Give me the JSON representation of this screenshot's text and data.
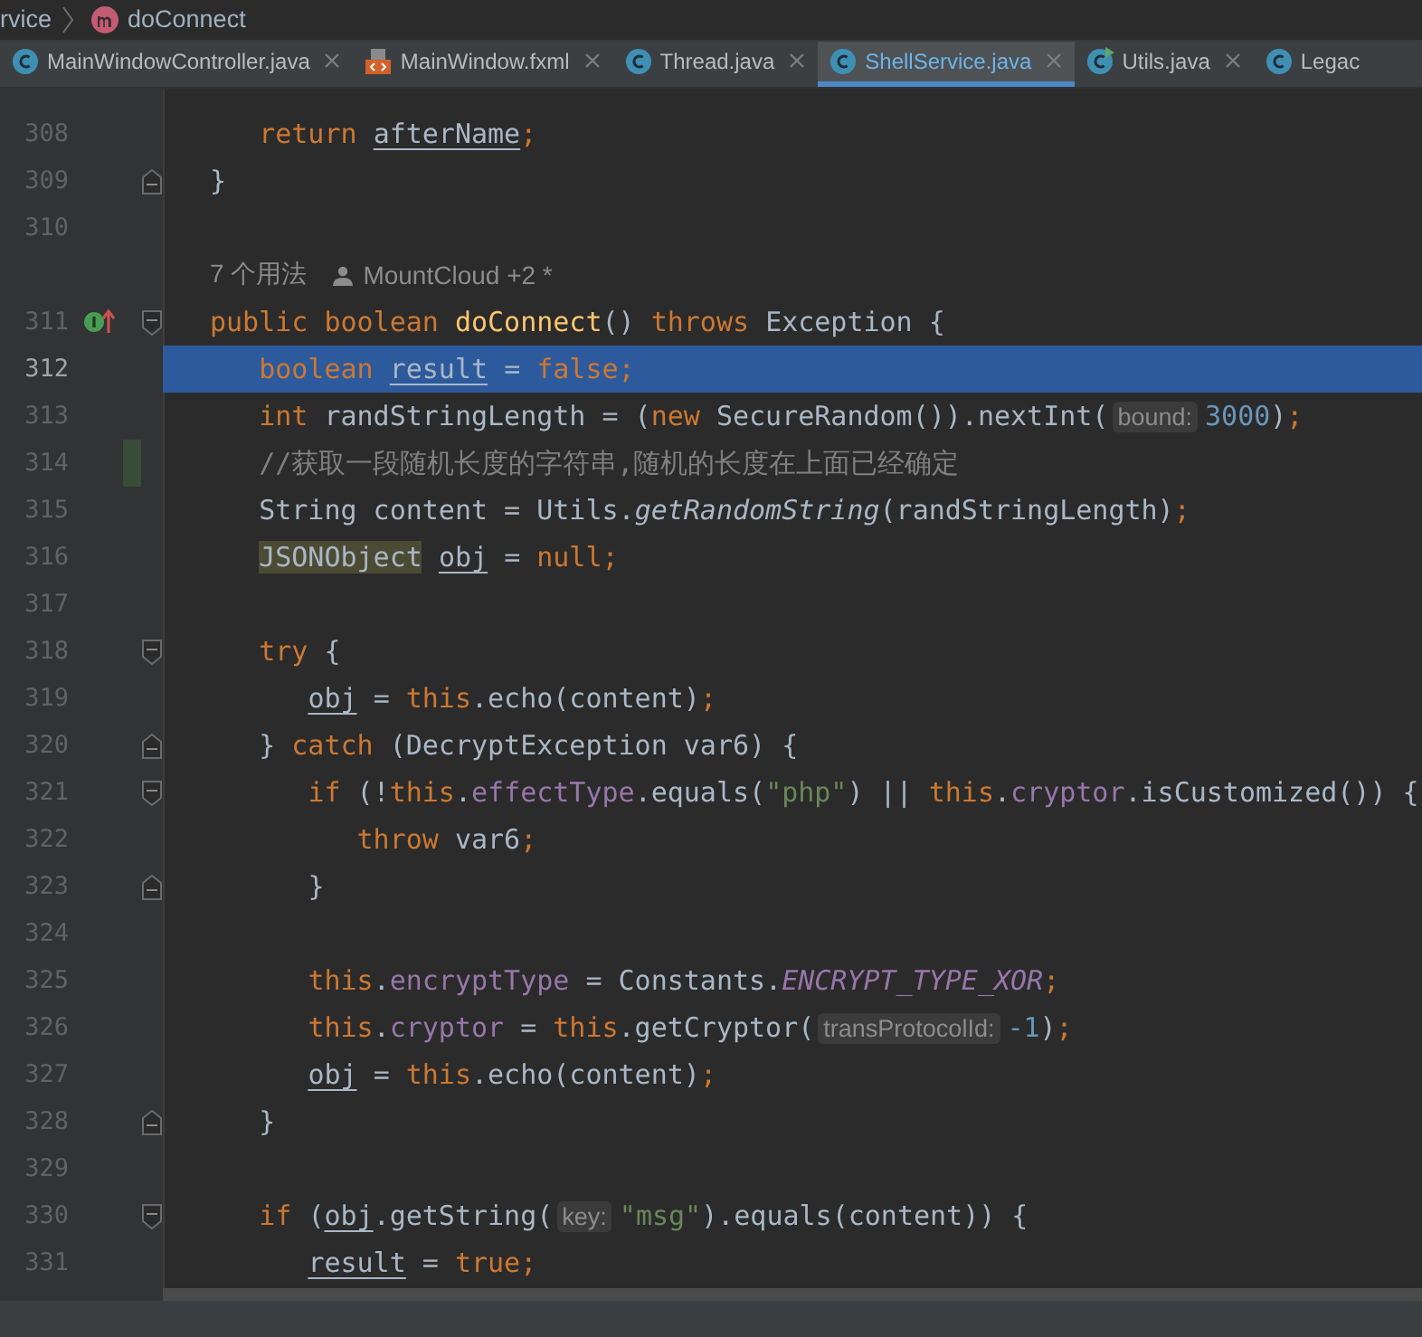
{
  "breadcrumb": [
    {
      "label": "rvice",
      "kind": "text"
    },
    {
      "label": "doConnect",
      "kind": "method"
    }
  ],
  "tabs": [
    {
      "label": "MainWindowController.java",
      "kind": "class",
      "selected": false,
      "closable": true
    },
    {
      "label": "MainWindow.fxml",
      "kind": "fxml",
      "selected": false,
      "closable": true
    },
    {
      "label": "Thread.java",
      "kind": "class",
      "selected": false,
      "closable": true
    },
    {
      "label": "ShellService.java",
      "kind": "class",
      "selected": true,
      "closable": true
    },
    {
      "label": "Utils.java",
      "kind": "runnable",
      "selected": false,
      "closable": true
    },
    {
      "label": "Legac",
      "kind": "class",
      "selected": false,
      "closable": false
    }
  ],
  "lines": [
    {
      "kind": "code",
      "num": "308",
      "selected": false,
      "tokens": [
        {
          "t": "   return ",
          "kind": "kw"
        },
        {
          "t": "afterName",
          "kind": "u"
        },
        {
          "t": ";",
          "kind": "kw"
        }
      ]
    },
    {
      "kind": "code",
      "num": "309",
      "selected": false,
      "block_end": true,
      "tokens": [
        {
          "t": "}",
          "kind": "p"
        }
      ]
    },
    {
      "kind": "code",
      "num": "310",
      "selected": false
    },
    {
      "kind": "lens",
      "usages": "7 个用法",
      "author": "MountCloud +2 *"
    },
    {
      "kind": "code",
      "num": "311",
      "selected": false,
      "block_start": true,
      "implements": true,
      "tokens": [
        {
          "t": "public ",
          "kind": "kw"
        },
        {
          "t": "boolean ",
          "kind": "kw"
        },
        {
          "t": "doConnect",
          "kind": "fn"
        },
        {
          "t": "() ",
          "kind": "p"
        },
        {
          "t": "throws",
          "kind": "kw"
        },
        {
          "t": " Exception {",
          "kind": "p"
        }
      ]
    },
    {
      "kind": "code",
      "num": "312",
      "selected": true,
      "tokens": [
        {
          "t": "   boolean ",
          "kind": "kw"
        },
        {
          "t": "result",
          "kind": "u"
        },
        {
          "t": " = ",
          "kind": "p"
        },
        {
          "t": "false;",
          "kind": "kw"
        }
      ]
    },
    {
      "kind": "code",
      "num": "313",
      "selected": false,
      "tokens": [
        {
          "t": "   int",
          "kind": "kw"
        },
        {
          "t": " randStringLength = (",
          "kind": "p"
        },
        {
          "t": "new",
          "kind": "kw"
        },
        {
          "t": " SecureRandom()).nextInt(",
          "kind": "p"
        },
        {
          "t": "bound:",
          "kind": "hint"
        },
        {
          "t": "3000",
          "kind": "num"
        },
        {
          "t": ")",
          "kind": "p"
        },
        {
          "t": ";",
          "kind": "kw"
        }
      ]
    },
    {
      "kind": "code",
      "num": "314",
      "selected": false,
      "changed": true,
      "tokens": [
        {
          "t": "   //获取一段随机长度的字符串,随机的长度在上面已经确定",
          "kind": "cm"
        }
      ]
    },
    {
      "kind": "code",
      "num": "315",
      "selected": false,
      "tokens": [
        {
          "t": "   String content = Utils.",
          "kind": "p"
        },
        {
          "t": "getRandomString",
          "kind": "mi"
        },
        {
          "t": "(randStringLength)",
          "kind": "p"
        },
        {
          "t": ";",
          "kind": "kw"
        }
      ]
    },
    {
      "kind": "code",
      "num": "316",
      "selected": false,
      "tokens": [
        {
          "t": "   JSONObject ",
          "kind": "hl"
        },
        {
          "t": "obj",
          "kind": "u"
        },
        {
          "t": " = ",
          "kind": "p"
        },
        {
          "t": "null;",
          "kind": "kw"
        }
      ]
    },
    {
      "kind": "code",
      "num": "317",
      "selected": false
    },
    {
      "kind": "code",
      "num": "318",
      "selected": false,
      "block_start": true,
      "tokens": [
        {
          "t": "   try",
          "kind": "kw"
        },
        {
          "t": " {",
          "kind": "p"
        }
      ]
    },
    {
      "kind": "code",
      "num": "319",
      "selected": false,
      "tokens": [
        {
          "t": "      obj",
          "kind": "u"
        },
        {
          "t": " = ",
          "kind": "p"
        },
        {
          "t": "this",
          "kind": "kw"
        },
        {
          "t": ".echo(content)",
          "kind": "p"
        },
        {
          "t": ";",
          "kind": "kw"
        }
      ]
    },
    {
      "kind": "code",
      "num": "320",
      "selected": false,
      "block_end": true,
      "tokens": [
        {
          "t": "   } ",
          "kind": "p"
        },
        {
          "t": "catch",
          "kind": "kw"
        },
        {
          "t": " (DecryptException var6) {",
          "kind": "p"
        }
      ]
    },
    {
      "kind": "code",
      "num": "321",
      "selected": false,
      "block_start": true,
      "tokens": [
        {
          "t": "      if",
          "kind": "kw"
        },
        {
          "t": " (!",
          "kind": "p"
        },
        {
          "t": "this",
          "kind": "kw"
        },
        {
          "t": ".",
          "kind": "p"
        },
        {
          "t": "effectType",
          "kind": "fld"
        },
        {
          "t": ".equals(",
          "kind": "p"
        },
        {
          "t": "\"php\"",
          "kind": "str"
        },
        {
          "t": ") || ",
          "kind": "p"
        },
        {
          "t": "this",
          "kind": "kw"
        },
        {
          "t": ".",
          "kind": "p"
        },
        {
          "t": "cryptor",
          "kind": "fld"
        },
        {
          "t": ".isCustomized()) {",
          "kind": "p"
        }
      ]
    },
    {
      "kind": "code",
      "num": "322",
      "selected": false,
      "tokens": [
        {
          "t": "         throw",
          "kind": "kw"
        },
        {
          "t": " var6",
          "kind": "p"
        },
        {
          "t": ";",
          "kind": "kw"
        }
      ]
    },
    {
      "kind": "code",
      "num": "323",
      "selected": false,
      "block_end": true,
      "tokens": [
        {
          "t": "      }",
          "kind": "p"
        }
      ]
    },
    {
      "kind": "code",
      "num": "324",
      "selected": false
    },
    {
      "kind": "code",
      "num": "325",
      "selected": false,
      "tokens": [
        {
          "t": "      this",
          "kind": "kw"
        },
        {
          "t": ".",
          "kind": "p"
        },
        {
          "t": "encryptType",
          "kind": "fld"
        },
        {
          "t": " = Constants.",
          "kind": "p"
        },
        {
          "t": "ENCRYPT_TYPE_XOR",
          "kind": "sti"
        },
        {
          "t": ";",
          "kind": "kw"
        }
      ]
    },
    {
      "kind": "code",
      "num": "326",
      "selected": false,
      "tokens": [
        {
          "t": "      this",
          "kind": "kw"
        },
        {
          "t": ".",
          "kind": "p"
        },
        {
          "t": "cryptor",
          "kind": "fld"
        },
        {
          "t": " = ",
          "kind": "p"
        },
        {
          "t": "this",
          "kind": "kw"
        },
        {
          "t": ".getCryptor(",
          "kind": "p"
        },
        {
          "t": "transProtocolId:",
          "kind": "hint"
        },
        {
          "t": "-1",
          "kind": "num"
        },
        {
          "t": ")",
          "kind": "p"
        },
        {
          "t": ";",
          "kind": "kw"
        }
      ]
    },
    {
      "kind": "code",
      "num": "327",
      "selected": false,
      "tokens": [
        {
          "t": "      obj",
          "kind": "u"
        },
        {
          "t": " = ",
          "kind": "p"
        },
        {
          "t": "this",
          "kind": "kw"
        },
        {
          "t": ".echo(content)",
          "kind": "p"
        },
        {
          "t": ";",
          "kind": "kw"
        }
      ]
    },
    {
      "kind": "code",
      "num": "328",
      "selected": false,
      "block_end": true,
      "tokens": [
        {
          "t": "   }",
          "kind": "p"
        }
      ]
    },
    {
      "kind": "code",
      "num": "329",
      "selected": false
    },
    {
      "kind": "code",
      "num": "330",
      "selected": false,
      "block_start": true,
      "tokens": [
        {
          "t": "   if",
          "kind": "kw"
        },
        {
          "t": " (",
          "kind": "p"
        },
        {
          "t": "obj",
          "kind": "u"
        },
        {
          "t": ".getString(",
          "kind": "p"
        },
        {
          "t": "key:",
          "kind": "hint"
        },
        {
          "t": "\"msg\"",
          "kind": "str"
        },
        {
          "t": ").equals(content)) {",
          "kind": "p"
        }
      ]
    },
    {
      "kind": "code",
      "num": "331",
      "selected": false,
      "tokens": [
        {
          "t": "      result",
          "kind": "u"
        },
        {
          "t": " = ",
          "kind": "p"
        },
        {
          "t": "true;",
          "kind": "kw"
        }
      ]
    }
  ]
}
